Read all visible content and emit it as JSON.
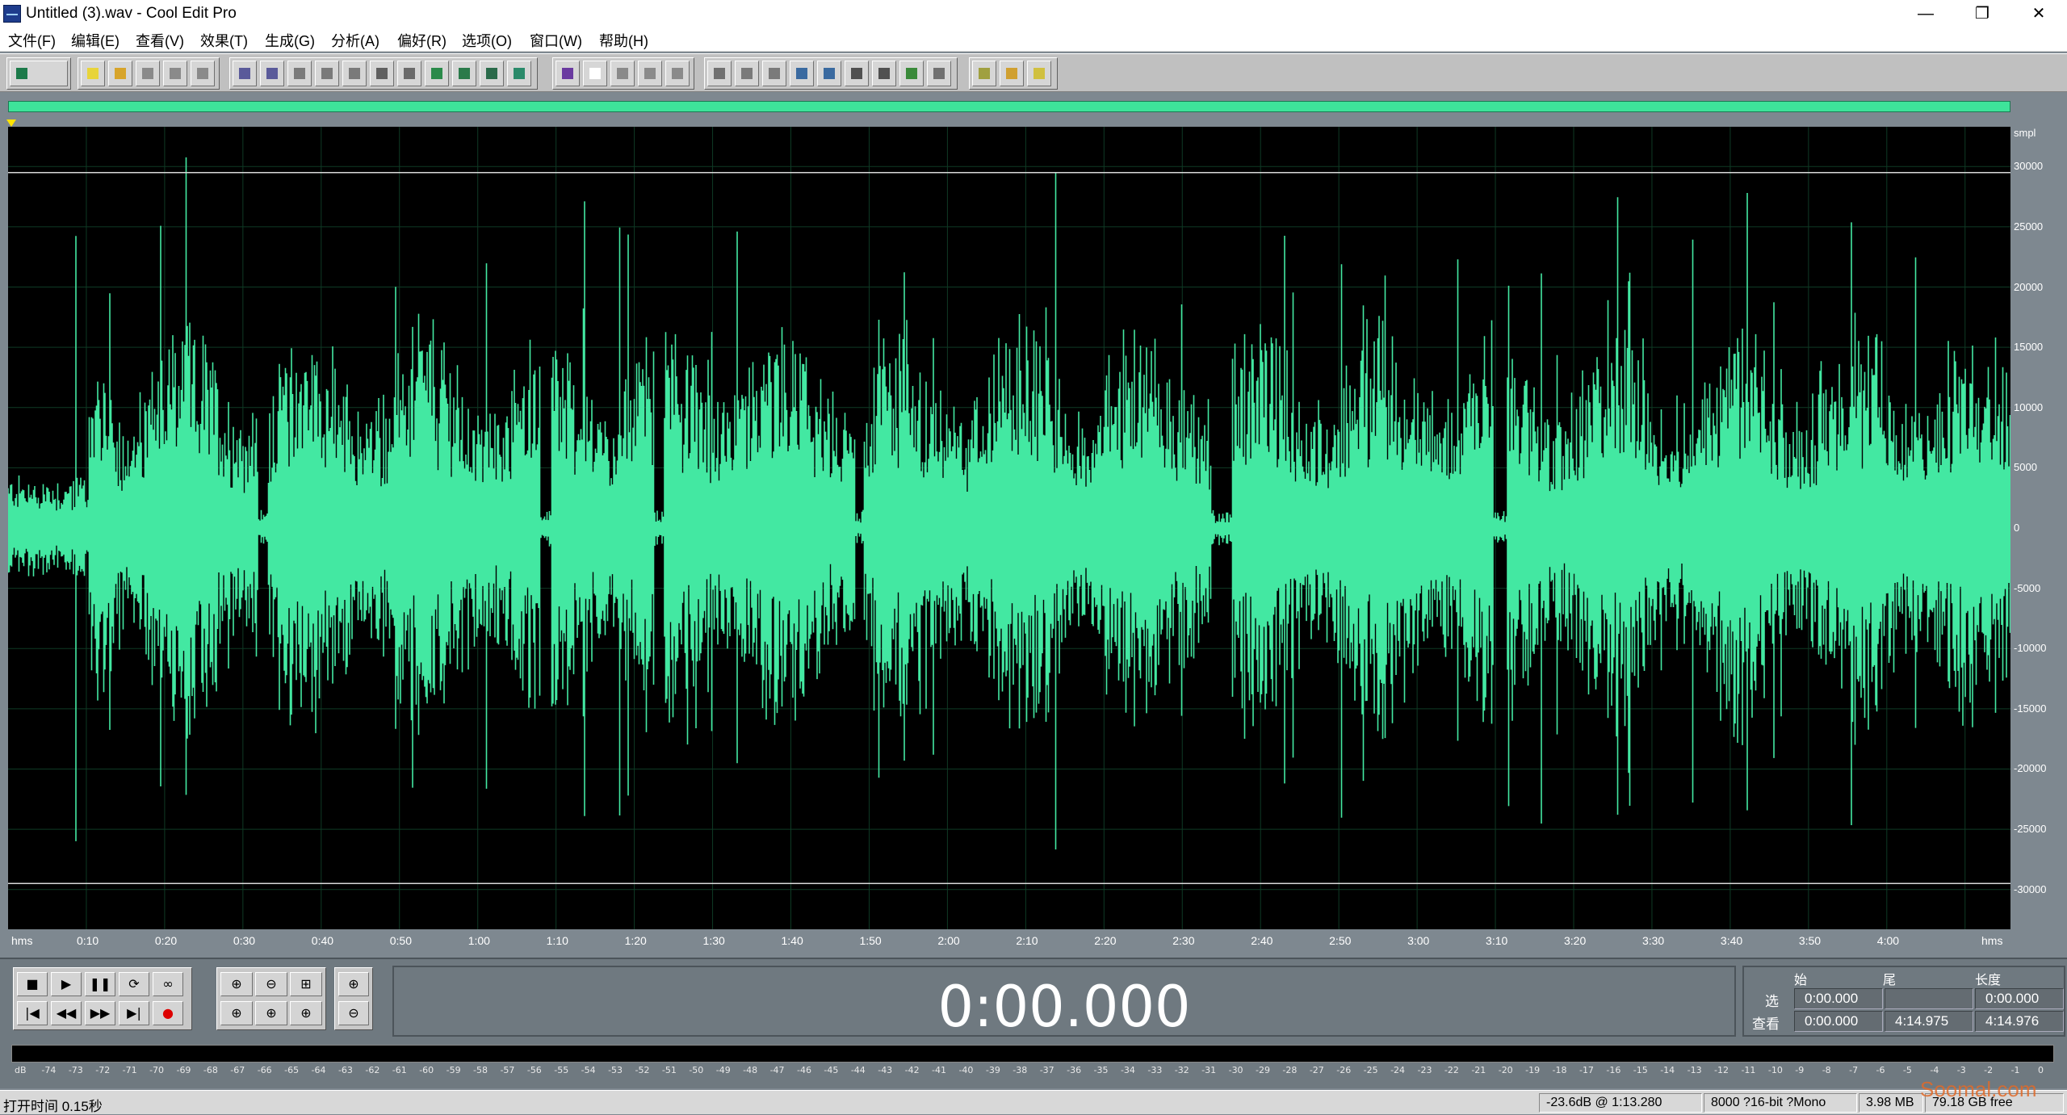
{
  "window": {
    "title": "Untitled (3).wav - Cool Edit Pro",
    "minimize": "—",
    "restore": "❐",
    "close": "✕"
  },
  "menu": [
    "文件(F)",
    "编辑(E)",
    "查看(V)",
    "效果(T)",
    "生成(G)",
    "分析(A)",
    "偏好(R)",
    "选项(O)",
    "窗口(W)",
    "帮助(H)"
  ],
  "toolbar_icons": {
    "group1": [
      "multitrack-icon"
    ],
    "group2": [
      "new-icon",
      "open-icon",
      "save-icon",
      "save-as-icon",
      "close-file-icon"
    ],
    "group3": [
      "undo-icon",
      "redo-icon",
      "repeat-icon",
      "copy-to-new-icon",
      "copy-icon",
      "cut-icon",
      "paste-icon",
      "paste-new-icon",
      "mix-paste-icon",
      "trim-icon",
      "crop-icon"
    ],
    "group4": [
      "spectral-view-icon",
      "graph-icon",
      "cue-list-icon",
      "play-list-icon",
      "info-icon"
    ],
    "group5": [
      "waveform-view-icon",
      "edit-view-icon",
      "marker-icon",
      "play-icon",
      "zoom-tool-icon",
      "time-format-icon",
      "grid-icon",
      "meter-icon",
      "status-icon"
    ],
    "group6": [
      "settings-icon",
      "script-icon",
      "help-icon"
    ]
  },
  "icon_colors": {
    "group1": [
      "#1c7a4a"
    ],
    "group2": [
      "#e8d43a",
      "#d7a42a",
      "#8a8a8a",
      "#8a8a8a",
      "#8a8a8a"
    ],
    "group3": [
      "#5a5a9a",
      "#5a5a9a",
      "#7a7a7a",
      "#7a7a7a",
      "#7a7a7a",
      "#606060",
      "#6a6a6a",
      "#2a8a4a",
      "#2a7a4a",
      "#2a6a4a",
      "#2a8a6a"
    ],
    "group4": [
      "#6a3aa0",
      "#ffffff",
      "#8a8a8a",
      "#8a8a8a",
      "#8a8a8a"
    ],
    "group5": [
      "#707070",
      "#7a7a7a",
      "#7a7a7a",
      "#3a6aa0",
      "#3a6aa0",
      "#505050",
      "#505050",
      "#3a8a3a",
      "#707070"
    ],
    "group6": [
      "#a0a040",
      "#d0a030",
      "#d0c040"
    ]
  },
  "waveform": {
    "color": "#43e8a2",
    "background": "#000000",
    "amplitude_unit": "smpl",
    "amplitude_ticks": [
      "30000",
      "25000",
      "20000",
      "15000",
      "10000",
      "5000",
      "0",
      "-5000",
      "-10000",
      "-15000",
      "-20000",
      "-25000",
      "-30000"
    ],
    "time_unit": "hms",
    "time_ticks": [
      "0:10",
      "0:20",
      "0:30",
      "0:40",
      "0:50",
      "1:00",
      "1:10",
      "1:20",
      "1:30",
      "1:40",
      "1:50",
      "2:00",
      "2:10",
      "2:20",
      "2:30",
      "2:40",
      "2:50",
      "3:00",
      "3:10",
      "3:20",
      "3:30",
      "3:40",
      "3:50",
      "4:00"
    ],
    "clip_level": 29500
  },
  "transport": {
    "buttons": [
      "■",
      "▶",
      "❚❚",
      "⟳",
      "∞",
      "|◀",
      "◀◀",
      "▶▶",
      "▶|",
      "●"
    ],
    "zoom_buttons": [
      "⊕",
      "⊖",
      "⊞",
      "⊕",
      "⊕",
      "⊕",
      "⊕",
      "⊖"
    ]
  },
  "time_display": "0:00.000",
  "selection": {
    "headers": [
      "始",
      "尾",
      "长度"
    ],
    "rows": [
      {
        "label": "选",
        "begin": "0:00.000",
        "end": "",
        "length": "0:00.000"
      },
      {
        "label": "查看",
        "begin": "0:00.000",
        "end": "4:14.975",
        "length": "4:14.976"
      }
    ]
  },
  "meter": {
    "labels": [
      "dB",
      "-74",
      "-73",
      "-72",
      "-71",
      "-70",
      "-69",
      "-68",
      "-67",
      "-66",
      "-65",
      "-64",
      "-63",
      "-62",
      "-61",
      "-60",
      "-59",
      "-58",
      "-57",
      "-56",
      "-55",
      "-54",
      "-53",
      "-52",
      "-51",
      "-50",
      "-49",
      "-48",
      "-47",
      "-46",
      "-45",
      "-44",
      "-43",
      "-42",
      "-41",
      "-40",
      "-39",
      "-38",
      "-37",
      "-36",
      "-35",
      "-34",
      "-33",
      "-32",
      "-31",
      "-30",
      "-29",
      "-28",
      "-27",
      "-26",
      "-25",
      "-24",
      "-23",
      "-22",
      "-21",
      "-20",
      "-19",
      "-18",
      "-17",
      "-16",
      "-15",
      "-14",
      "-13",
      "-12",
      "-11",
      "-10",
      "-9",
      "-8",
      "-7",
      "-6",
      "-5",
      "-4",
      "-3",
      "-2",
      "-1",
      "0"
    ]
  },
  "status": {
    "left": "打开时间  0.15秒",
    "level": "-23.6dB @  1:13.280",
    "format": "8000 ?16-bit ?Mono",
    "size": "3.98 MB",
    "free": "79.18 GB free"
  },
  "watermark": "Soomal.com"
}
